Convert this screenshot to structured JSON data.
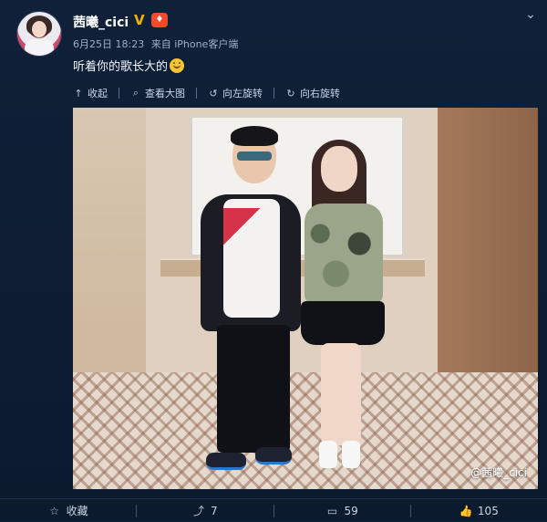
{
  "post": {
    "username": "茜曦_cici",
    "meta": {
      "date_time": "6月25日 18:23",
      "source": "来自 iPhone客户端"
    },
    "text": "听着你的歌长大的"
  },
  "toolbar": {
    "collapse": "收起",
    "view_large": "查看大图",
    "rotate_left": "向左旋转",
    "rotate_right": "向右旋转"
  },
  "watermark": "@茜曦_cici",
  "actions": {
    "favorite": "收藏",
    "share_count": "7",
    "comment_count": "59",
    "like_count": "105"
  },
  "icons": {
    "verified": "verified-icon",
    "vip": "vip-icon",
    "dropdown": "chevron-down-icon"
  },
  "colors": {
    "background": "#0d1d33",
    "text": "#e8eef6",
    "verified": "#f5b400",
    "vip": "#f24b2a"
  }
}
